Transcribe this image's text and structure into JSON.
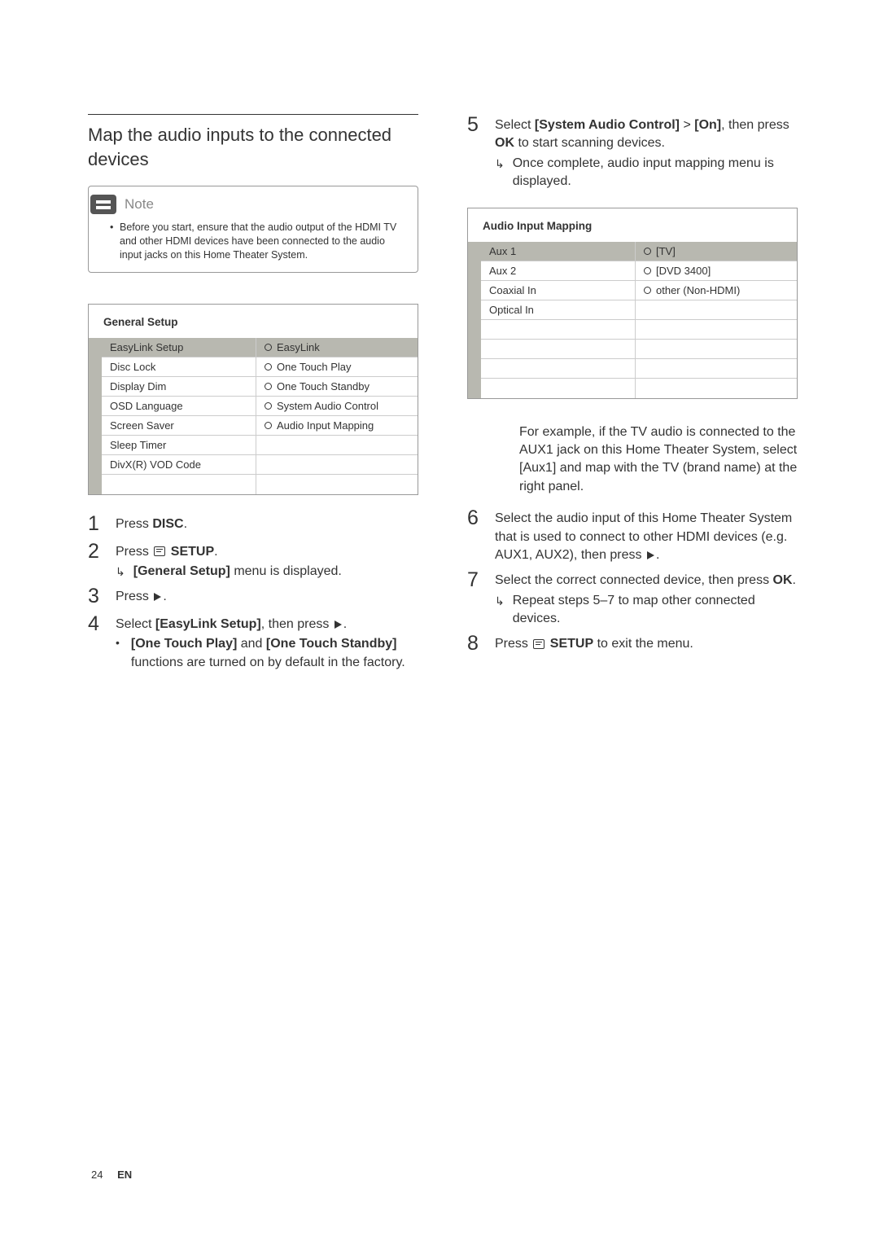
{
  "left": {
    "heading": "Map the audio inputs to the connected devices",
    "note": {
      "label": "Note",
      "text": "Before you start, ensure that the audio output of the HDMI TV and other HDMI devices have been connected to the audio input jacks on this Home Theater System."
    },
    "generalSetup": {
      "title": "General Setup",
      "leftItems": [
        "EasyLink Setup",
        "Disc Lock",
        "Display Dim",
        "OSD Language",
        "Screen Saver",
        "Sleep Timer",
        "DivX(R) VOD Code"
      ],
      "rightItems": [
        "EasyLink",
        "One Touch Play",
        "One Touch Standby",
        "System Audio Control",
        "Audio Input Mapping"
      ]
    },
    "steps": {
      "s1_a": "Press ",
      "s1_b": "DISC",
      "s1_c": ".",
      "s2_a": "Press ",
      "s2_b": " SETUP",
      "s2_c": ".",
      "s2_sub_a": "[General Setup]",
      "s2_sub_b": " menu is displayed.",
      "s3_a": "Press ",
      "s3_b": ".",
      "s4_a": "Select ",
      "s4_b": "[EasyLink Setup]",
      "s4_c": ", then press ",
      "s4_d": ".",
      "s4_sub_a": "[One Touch Play]",
      "s4_sub_b": " and ",
      "s4_sub_c": "[One Touch Standby]",
      "s4_sub_d": " functions are turned on by default in the factory."
    }
  },
  "right": {
    "step5": {
      "num": "5",
      "a": "Select ",
      "b": "[System Audio Control]",
      "c": " > ",
      "d": "[On]",
      "e": ", then press ",
      "f": "OK",
      "g": " to start scanning devices.",
      "sub": "Once complete, audio input mapping menu is displayed."
    },
    "audioMapping": {
      "title": "Audio Input Mapping",
      "leftItems": [
        "Aux 1",
        "Aux 2",
        "Coaxial In",
        "Optical In"
      ],
      "rightItems": [
        "[TV]",
        "[DVD 3400]",
        "other (Non-HDMI)"
      ]
    },
    "example": {
      "a": "For example, if the TV audio is connected to the ",
      "b": "AUX1",
      "c": " jack on this Home Theater System, select ",
      "d": "[Aux1]",
      "e": " and map with the TV (brand name) at the right panel."
    },
    "step6": {
      "num": "6",
      "a": "Select the audio input of this Home Theater System that is used to connect to other HDMI devices (e.g. AUX1, AUX2), then press ",
      "b": "."
    },
    "step7": {
      "num": "7",
      "a": "Select the correct connected device, then press ",
      "b": "OK",
      "c": ".",
      "sub": "Repeat steps 5–7 to map other connected devices."
    },
    "step8": {
      "num": "8",
      "a": "Press ",
      "b": " SETUP",
      "c": " to exit the menu."
    }
  },
  "footer": {
    "page": "24",
    "lang": "EN"
  }
}
